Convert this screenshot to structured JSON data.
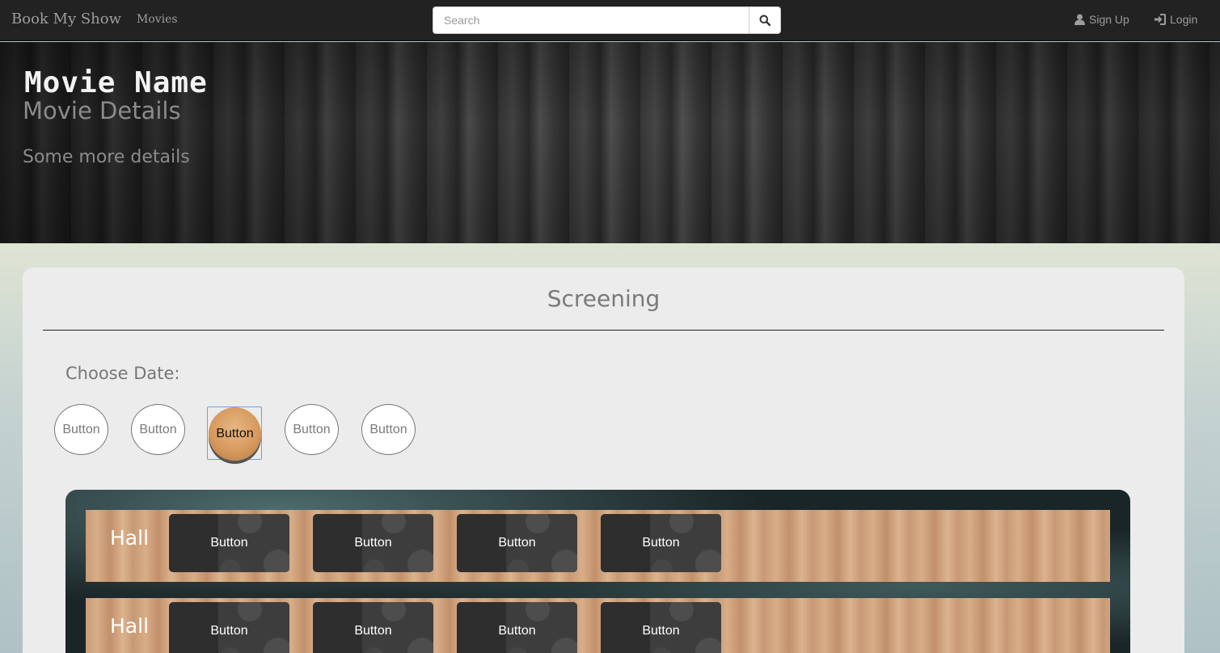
{
  "navbar": {
    "brand": "Book My Show",
    "movies_link": "Movies",
    "search_placeholder": "Search",
    "signup_label": "Sign Up",
    "login_label": "Login"
  },
  "hero": {
    "title": "Movie Name",
    "subtitle": "Movie Details",
    "more": "Some more details"
  },
  "screening": {
    "title": "Screening",
    "choose_date_label": "Choose Date:",
    "date_buttons": [
      "Button",
      "Button",
      "Button",
      "Button",
      "Button"
    ],
    "selected_date_index": 2
  },
  "halls": [
    {
      "label": "Hall",
      "shows": [
        "Button",
        "Button",
        "Button",
        "Button"
      ]
    },
    {
      "label": "Hall",
      "shows": [
        "Button",
        "Button",
        "Button",
        "Button"
      ]
    }
  ],
  "colors": {
    "navbar_bg": "#222222",
    "selected_date": "#d79a5e",
    "show_button": "#2e2e2e"
  }
}
